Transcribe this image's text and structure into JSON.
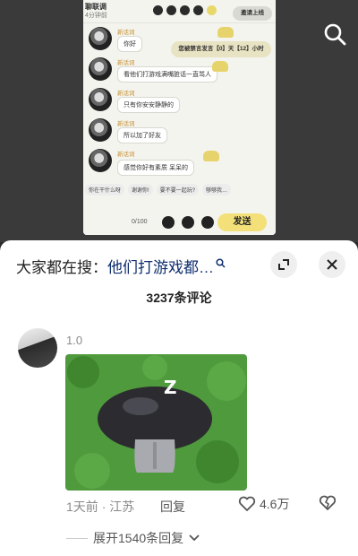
{
  "video": {
    "chat_header": {
      "name": "聊联调",
      "time": "4分钟前",
      "button": "邀请上线"
    },
    "system_notice": "您被禁言发言【0】天【12】小时",
    "messages": [
      {
        "name": "新话词",
        "text": "你好"
      },
      {
        "name": "新话词",
        "text": "看他们打游戏满嘴脏话一直骂人"
      },
      {
        "name": "新话词",
        "text": "只有你安安静静的"
      },
      {
        "name": "新话词",
        "text": "所以加了好友"
      },
      {
        "name": "新话词",
        "text": "感觉你好有素质 呆呆的"
      }
    ],
    "quick_replies": [
      "你在干什么呀",
      "谢谢你!",
      "要不要一起玩?",
      "够够我…"
    ],
    "counter": "0/100",
    "send_label": "发送"
  },
  "sheet": {
    "search_prefix": "大家都在搜：",
    "search_query": "他们打游戏都…",
    "comment_count": "3237条评论",
    "comment": {
      "username": "1.0",
      "time": "1天前",
      "location": "江苏",
      "reply_label": "回复",
      "likes": "4.6万",
      "expand_label": "展开1540条回复"
    }
  },
  "colors": {
    "accent": "#f3e079",
    "link": "#0f2e6e",
    "grass": "#4f9a3c"
  }
}
